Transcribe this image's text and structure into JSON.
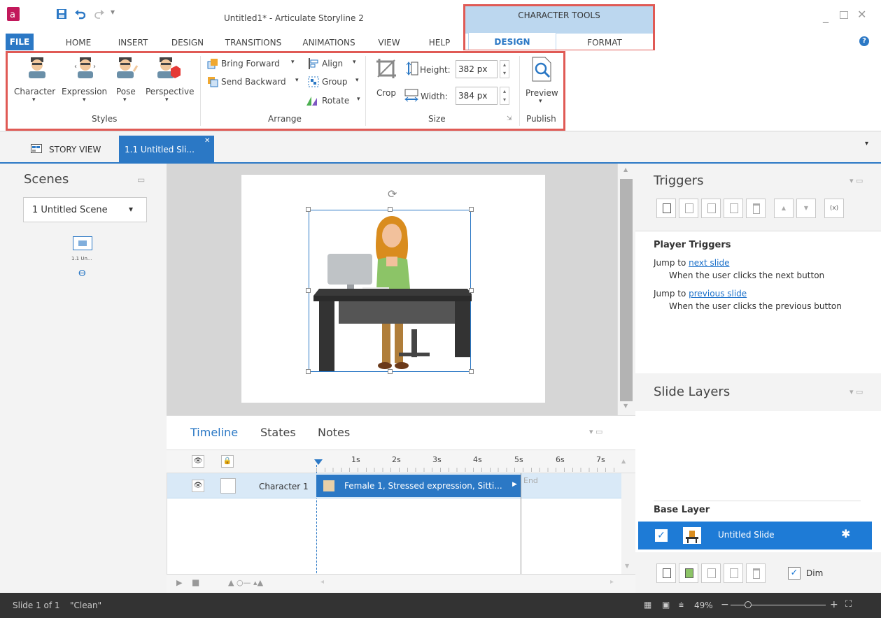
{
  "window": {
    "title": "Untitled1* - Articulate Storyline 2"
  },
  "context_tab_group": {
    "label": "CHARACTER TOOLS",
    "tabs": [
      "DESIGN",
      "FORMAT"
    ]
  },
  "menu_tabs": [
    "FILE",
    "HOME",
    "INSERT",
    "DESIGN",
    "TRANSITIONS",
    "ANIMATIONS",
    "VIEW",
    "HELP"
  ],
  "ribbon": {
    "styles": {
      "character": "Character",
      "expression": "Expression",
      "pose": "Pose",
      "perspective": "Perspective",
      "group": "Styles"
    },
    "arrange": {
      "bring_forward": "Bring Forward",
      "send_backward": "Send Backward",
      "align": "Align",
      "group_btn": "Group",
      "rotate": "Rotate",
      "group": "Arrange"
    },
    "size": {
      "crop": "Crop",
      "height_label": "Height:",
      "height_value": "382 px",
      "width_label": "Width:",
      "width_value": "384 px",
      "group": "Size"
    },
    "publish": {
      "preview": "Preview",
      "group": "Publish"
    }
  },
  "doc_tabs": {
    "story_view": "STORY VIEW",
    "slide_tab": "1.1 Untitled Sli..."
  },
  "scenes": {
    "title": "Scenes",
    "selected": "1 Untitled Scene",
    "thumb_label": "1.1 Un..."
  },
  "triggers": {
    "title": "Triggers",
    "section": "Player Triggers",
    "items": [
      {
        "action": "Jump to",
        "target": "next slide",
        "condition": "When the user clicks the next button"
      },
      {
        "action": "Jump to",
        "target": "previous slide",
        "condition": "When the user clicks the previous button"
      }
    ]
  },
  "layers": {
    "title": "Slide Layers",
    "base_label": "Base Layer",
    "slide_name": "Untitled Slide",
    "dim": "Dim"
  },
  "timeline": {
    "tabs": [
      "Timeline",
      "States",
      "Notes"
    ],
    "ticks": [
      "1s",
      "2s",
      "3s",
      "4s",
      "5s",
      "6s",
      "7s"
    ],
    "row_name": "Character 1",
    "bar_text": "Female 1, Stressed expression, Sitti...",
    "end_label": "End"
  },
  "status": {
    "slide": "Slide 1 of 1",
    "theme": "\"Clean\"",
    "zoom": "49%"
  },
  "colors": {
    "accent": "#2b78c5",
    "context_tab": "#bcd7ef",
    "highlight": "#e05a55",
    "status_bar": "#333333"
  }
}
